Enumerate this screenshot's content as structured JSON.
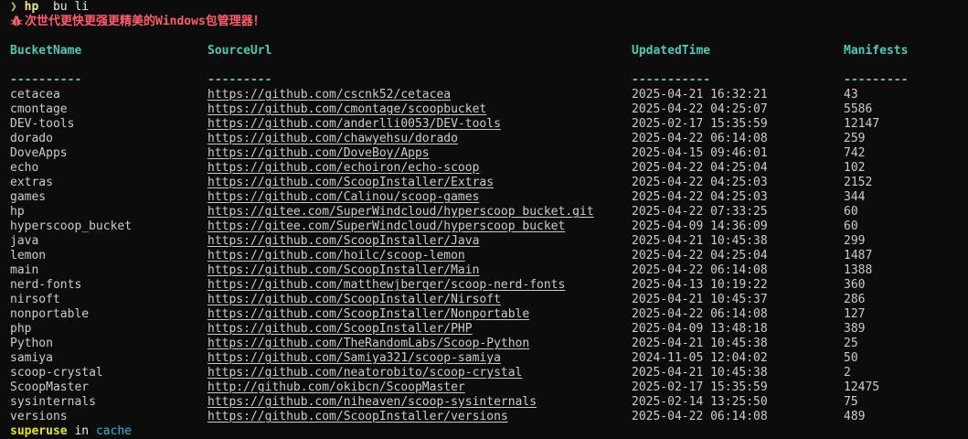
{
  "command": {
    "arrow": "❯",
    "program": "hp",
    "args": "bu li"
  },
  "banner": {
    "icon": "bug-icon",
    "text": "次世代更快更强更精美的Windows包管理器！"
  },
  "table": {
    "headers": [
      "BucketName",
      "SourceUrl",
      "UpdatedTime",
      "Manifests"
    ],
    "separators": [
      "----------",
      "---------",
      "-----------",
      "---------"
    ],
    "rows": [
      [
        "cetacea",
        "https://github.com/cscnk52/cetacea",
        "2025-04-21 16:32:21",
        "43"
      ],
      [
        "cmontage",
        "https://github.com/cmontage/scoopbucket",
        "2025-04-22 04:25:07",
        "5586"
      ],
      [
        "DEV-tools",
        "https://github.com/anderlli0053/DEV-tools",
        "2025-02-17 15:35:59",
        "12147"
      ],
      [
        "dorado",
        "https://github.com/chawyehsu/dorado",
        "2025-04-22 06:14:08",
        "259"
      ],
      [
        "DoveApps",
        "https://github.com/DoveBoy/Apps",
        "2025-04-15 09:46:01",
        "742"
      ],
      [
        "echo",
        "https://github.com/echoiron/echo-scoop",
        "2025-04-22 04:25:04",
        "102"
      ],
      [
        "extras",
        "https://github.com/ScoopInstaller/Extras",
        "2025-04-22 04:25:03",
        "2152"
      ],
      [
        "games",
        "https://github.com/Calinou/scoop-games",
        "2025-04-22 04:25:03",
        "344"
      ],
      [
        "hp",
        "https://gitee.com/SuperWindcloud/hyperscoop_bucket.git",
        "2025-04-22 07:33:25",
        "60"
      ],
      [
        "hyperscoop_bucket",
        "https://gitee.com/SuperWindcloud/hyperscoop_bucket",
        "2025-04-09 14:36:09",
        "60"
      ],
      [
        "java",
        "https://github.com/ScoopInstaller/Java",
        "2025-04-21 10:45:38",
        "299"
      ],
      [
        "lemon",
        "https://github.com/hoilc/scoop-lemon",
        "2025-04-22 04:25:04",
        "1487"
      ],
      [
        "main",
        "https://github.com/ScoopInstaller/Main",
        "2025-04-22 06:14:08",
        "1388"
      ],
      [
        "nerd-fonts",
        "https://github.com/matthewjberger/scoop-nerd-fonts",
        "2025-04-13 10:19:22",
        "360"
      ],
      [
        "nirsoft",
        "https://github.com/ScoopInstaller/Nirsoft",
        "2025-04-21 10:45:37",
        "286"
      ],
      [
        "nonportable",
        "https://github.com/ScoopInstaller/Nonportable",
        "2025-04-22 06:14:08",
        "127"
      ],
      [
        "php",
        "https://github.com/ScoopInstaller/PHP",
        "2025-04-09 13:48:18",
        "389"
      ],
      [
        "Python",
        "https://github.com/TheRandomLabs/Scoop-Python",
        "2025-04-21 10:45:38",
        "25"
      ],
      [
        "samiya",
        "https://github.com/Samiya321/scoop-samiya",
        "2024-11-05 12:04:02",
        "50"
      ],
      [
        "scoop-crystal",
        "https://github.com/neatorobito/scoop-crystal",
        "2025-04-21 10:45:38",
        "2"
      ],
      [
        "ScoopMaster",
        "http://github.com/okibcn/ScoopMaster",
        "2025-02-17 15:35:59",
        "12475"
      ],
      [
        "sysinternals",
        "https://github.com/niheaven/scoop-sysinternals",
        "2025-02-14 13:25:50",
        "75"
      ],
      [
        "versions",
        "https://github.com/ScoopInstaller/versions",
        "2025-04-22 06:14:08",
        "489"
      ]
    ]
  },
  "next_prompt": {
    "user": "superuse",
    "word": "in",
    "dir": "cache"
  },
  "colors": {
    "background": "#0c0c0c",
    "header": "#4ec9b0",
    "banner": "#ff5c6c",
    "prompt_user": "#e5e510",
    "prompt_dir": "#29b8db"
  }
}
